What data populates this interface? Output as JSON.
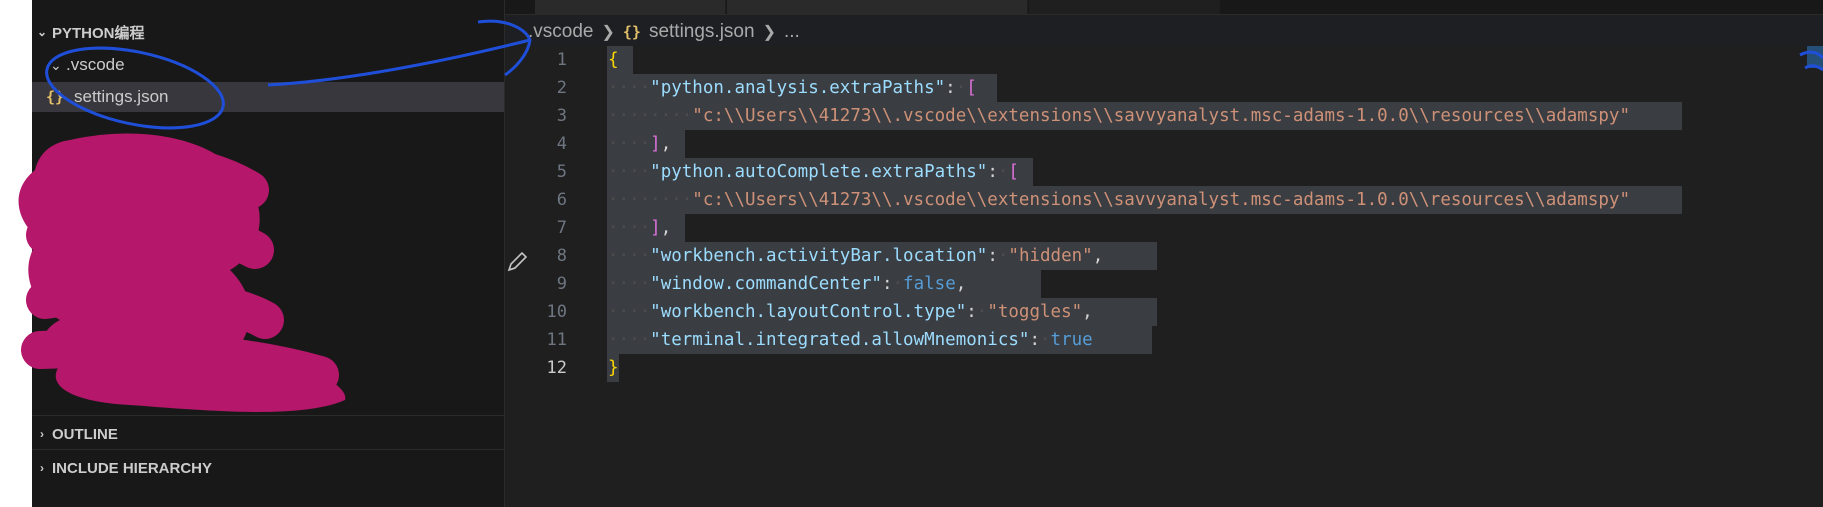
{
  "sidebar": {
    "workspace_title": "PYTHON编程",
    "folder": ".vscode",
    "file_icon": "{}",
    "file": "settings.json",
    "outline_title": "OUTLINE",
    "include_hierarchy_title": "INCLUDE HIERARCHY"
  },
  "breadcrumb": {
    "folder": ".vscode",
    "file_icon": "{}",
    "file": "settings.json",
    "more": "..."
  },
  "editor": {
    "line_numbers": [
      "1",
      "2",
      "3",
      "4",
      "5",
      "6",
      "7",
      "8",
      "9",
      "10",
      "11",
      "12"
    ],
    "active_line": "12",
    "open_brace": "{",
    "close_brace": "}",
    "key_extra_paths": "\"python.analysis.extraPaths\"",
    "path_value_1": "\"c:\\\\Users\\\\41273\\\\.vscode\\\\extensions\\\\savvyanalyst.msc-adams-1.0.0\\\\resources\\\\adamspy\"",
    "key_autocomplete_paths": "\"python.autoComplete.extraPaths\"",
    "path_value_2": "\"c:\\\\Users\\\\41273\\\\.vscode\\\\extensions\\\\savvyanalyst.msc-adams-1.0.0\\\\resources\\\\adamspy\"",
    "key_activity_bar": "\"workbench.activityBar.location\"",
    "val_activity_bar": "\"hidden\"",
    "key_command_center": "\"window.commandCenter\"",
    "val_command_center": "false",
    "key_layout_control": "\"workbench.layoutControl.type\"",
    "val_layout_control": "\"toggles\"",
    "key_mnemonics": "\"terminal.integrated.allowMnemonics\"",
    "val_mnemonics": "true",
    "open_bracket": "[",
    "close_bracket": "]",
    "colon": ":",
    "comma": ","
  },
  "colors": {
    "key": "#9cdcfe",
    "string": "#ce9178",
    "boolean": "#569cd6",
    "brace": "#ffd700",
    "bracket": "#da70d6",
    "scribble_magenta": "#b5176a",
    "annotation_blue": "#1f4fd8"
  },
  "icons": [
    "chevron-down-icon",
    "json-file-icon",
    "pencil-edit-icon",
    "chevron-right-icon"
  ]
}
